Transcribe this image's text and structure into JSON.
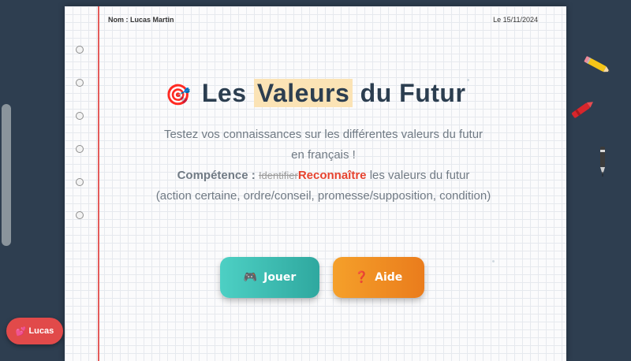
{
  "header": {
    "name_label": "Nom : Lucas Martin",
    "date_label": "Le 15/11/2024"
  },
  "title": {
    "icon": "target-icon",
    "part1": "Les",
    "highlight": "Valeurs",
    "part2": "du Futur"
  },
  "description": {
    "line1": "Testez vos connaissances sur les différentes valeurs du futur",
    "line2": "en français !"
  },
  "competence": {
    "label": "Compétence :",
    "struck": "Identifier",
    "replacement": "Reconnaître",
    "text": "les valeurs du futur",
    "details": "(action certaine, ordre/conseil, promesse/supposition, condition)"
  },
  "buttons": {
    "play": {
      "icon": "gamepad-icon",
      "label": "Jouer"
    },
    "help": {
      "icon": "question-icon",
      "label": "Aide"
    }
  },
  "user": {
    "icon": "heart-icon",
    "label": "Lucas"
  },
  "colors": {
    "background": "#2e3e50",
    "title": "#2c3e50",
    "highlight": "#fbe3b5",
    "accent_red": "#e6432f",
    "play_button": "#3cbfb4",
    "help_button": "#f08c22",
    "user_pill": "#e14a4a"
  }
}
